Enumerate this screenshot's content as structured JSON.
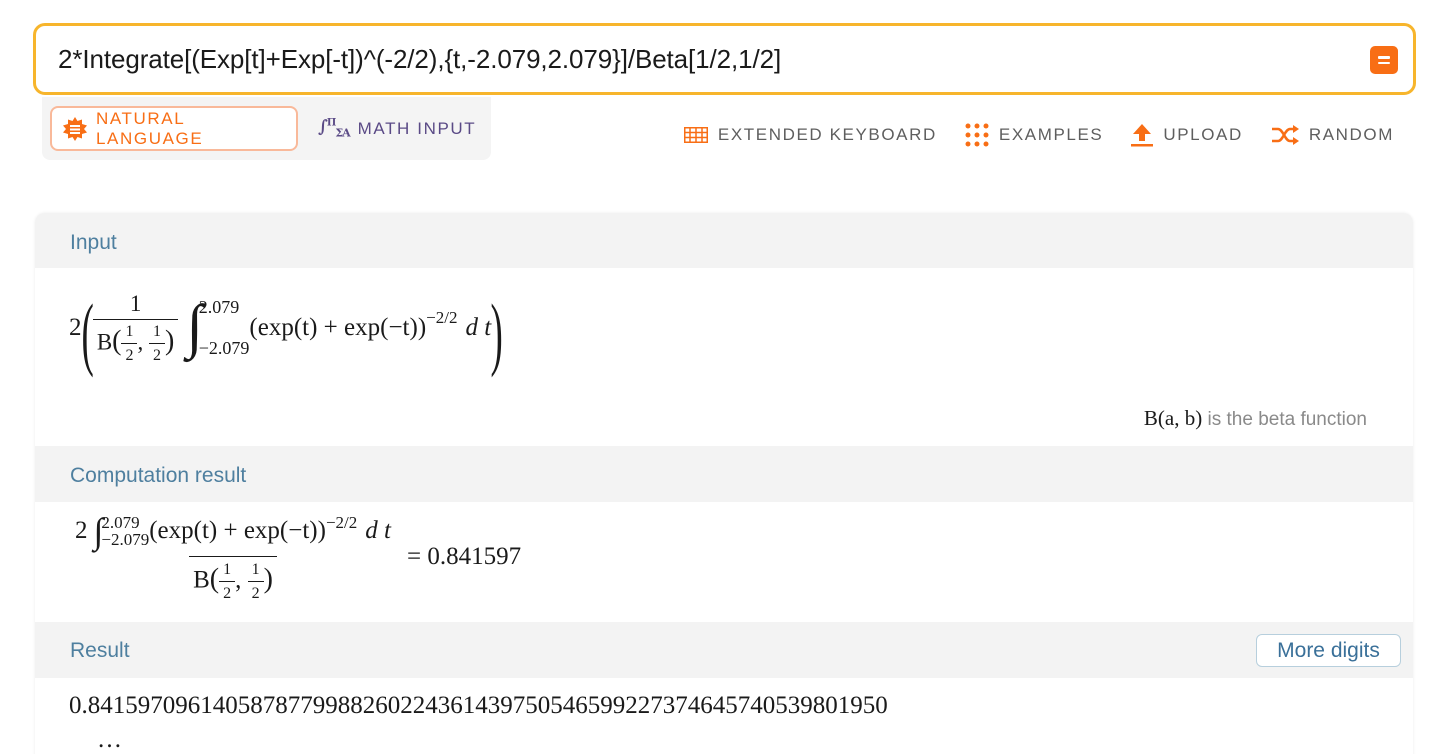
{
  "search": {
    "query": "2*Integrate[(Exp[t]+Exp[-t])^(-2/2),{t,-2.079,2.079}]/Beta[1/2,1/2]",
    "submit_icon": "equals-icon",
    "accent_color": "#f7b52c",
    "button_color": "#f86e15"
  },
  "modes": {
    "natural_language": "NATURAL LANGUAGE",
    "math_input": "MATH INPUT",
    "math_icon_text": "∫π Σα"
  },
  "toolbar": {
    "extended_keyboard": "EXTENDED KEYBOARD",
    "examples": "EXAMPLES",
    "upload": "UPLOAD",
    "random": "RANDOM"
  },
  "pods": {
    "input": {
      "title": "Input",
      "coef": "2",
      "frac_num": "1",
      "beta": "B",
      "half": "1",
      "two": "2",
      "upper": "2.079",
      "lower": "−2.079",
      "integrand": "(exp(t) + exp(−t))",
      "exponent": "−2/2",
      "dt": "d t",
      "note_fn": "B(a, b)",
      "note_text": " is the beta function"
    },
    "computation": {
      "title": "Computation result",
      "coef": "2",
      "upper": "2.079",
      "lower": "−2.079",
      "integrand": "(exp(t) + exp(−t))",
      "exponent": "−2/2",
      "dt": "d t",
      "beta": "B",
      "equals": "= 0.841597"
    },
    "result": {
      "title": "Result",
      "more_digits": "More digits",
      "value": "0.84159709614058787799882602243614397505465992273746457405398019 50",
      "value_display": "0.8415970961405878779988260224361439750546599227374645740539801950",
      "ellipsis": "…"
    }
  }
}
